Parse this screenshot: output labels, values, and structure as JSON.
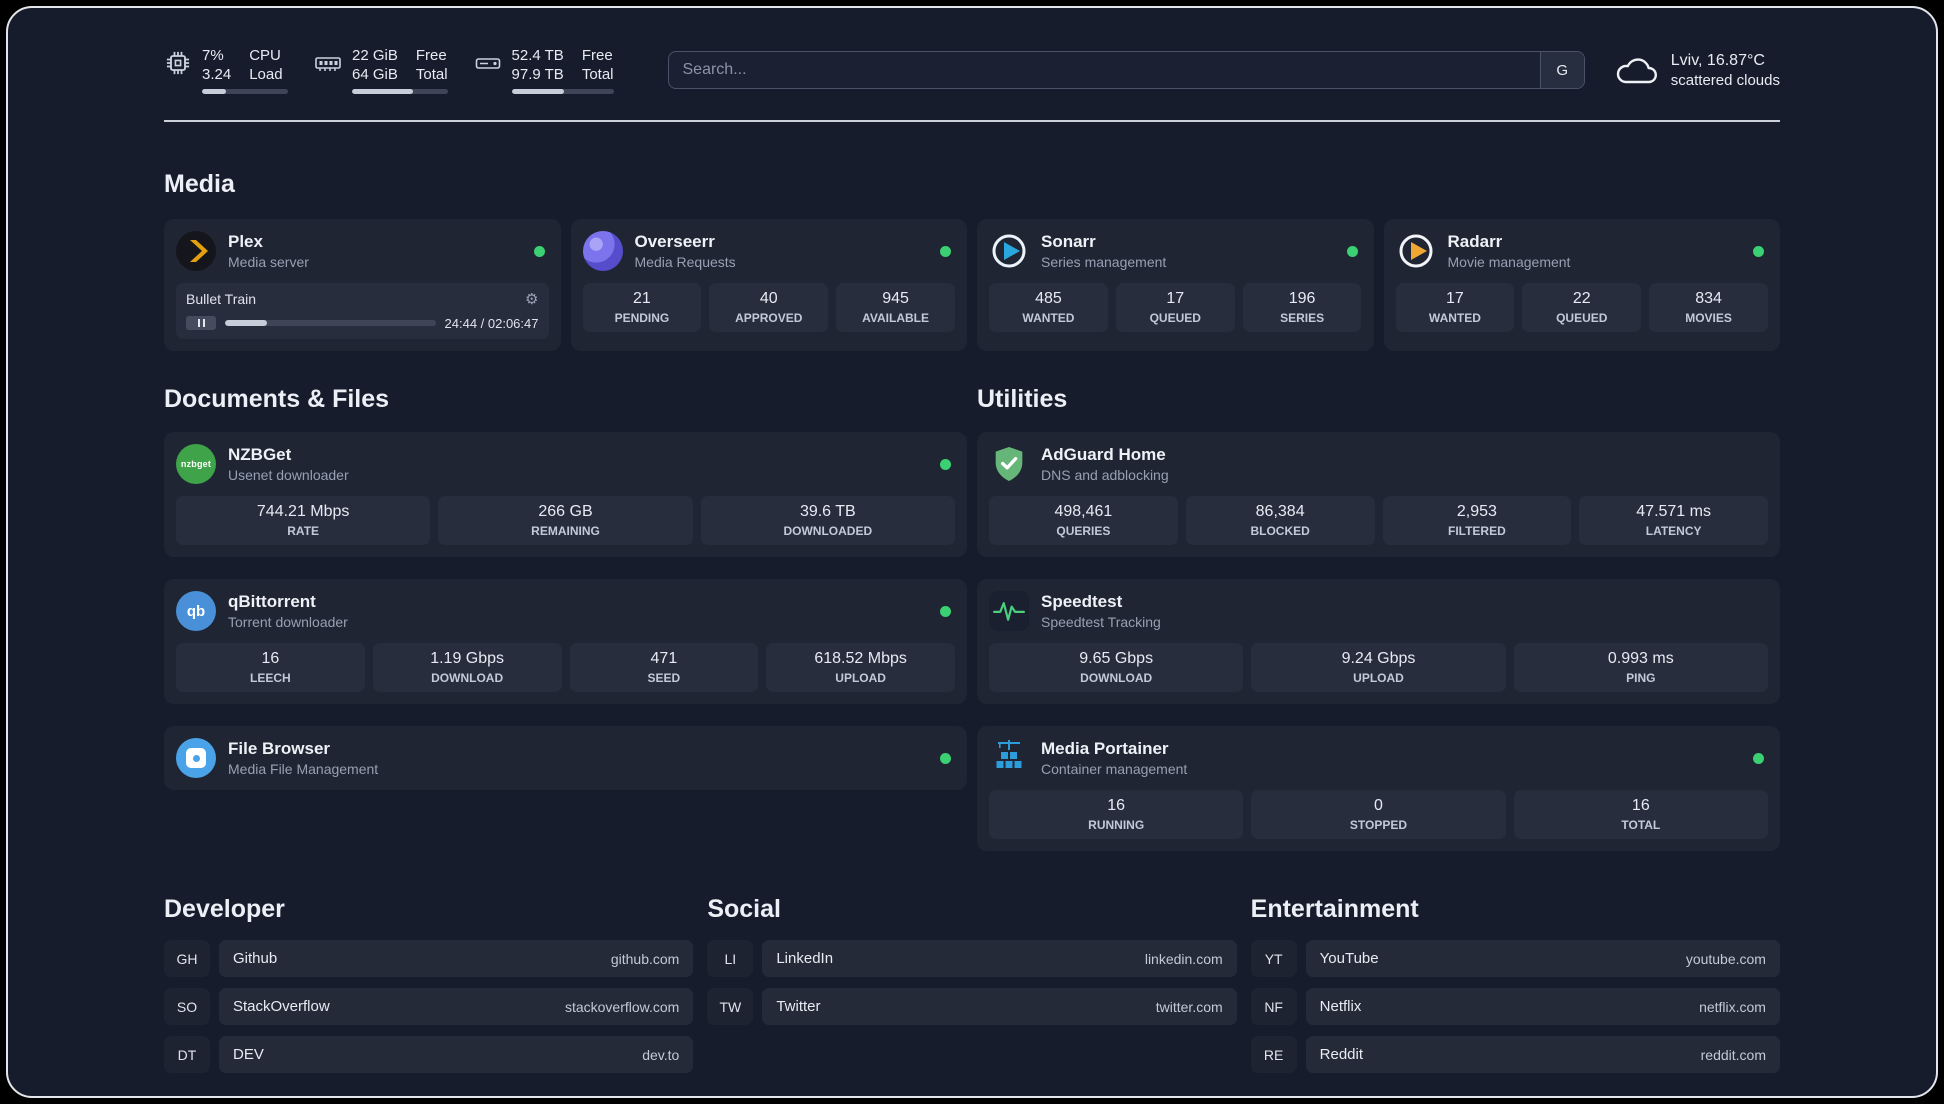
{
  "header": {
    "cpu": {
      "value1": "7%",
      "value2": "3.24",
      "label1": "CPU",
      "label2": "Load",
      "bar_pct": 28
    },
    "ram": {
      "value1": "22 GiB",
      "value2": "64 GiB",
      "label1": "Free",
      "label2": "Total",
      "bar_pct": 64
    },
    "disk": {
      "value1": "52.4 TB",
      "value2": "97.9 TB",
      "label1": "Free",
      "label2": "Total",
      "bar_pct": 51
    },
    "search": {
      "placeholder": "Search...",
      "button": "G"
    },
    "weather": {
      "location": "Lviv, 16.87°C",
      "condition": "scattered clouds"
    }
  },
  "media": {
    "title": "Media",
    "plex": {
      "name": "Plex",
      "subtitle": "Media server",
      "now_playing": "Bullet Train",
      "time": "24:44 / 02:06:47",
      "progress_pct": 20,
      "gear_glyph": "⚙"
    },
    "overseerr": {
      "name": "Overseerr",
      "subtitle": "Media Requests",
      "stats": [
        {
          "value": "21",
          "label": "PENDING"
        },
        {
          "value": "40",
          "label": "APPROVED"
        },
        {
          "value": "945",
          "label": "AVAILABLE"
        }
      ]
    },
    "sonarr": {
      "name": "Sonarr",
      "subtitle": "Series management",
      "stats": [
        {
          "value": "485",
          "label": "WANTED"
        },
        {
          "value": "17",
          "label": "QUEUED"
        },
        {
          "value": "196",
          "label": "SERIES"
        }
      ]
    },
    "radarr": {
      "name": "Radarr",
      "subtitle": "Movie management",
      "stats": [
        {
          "value": "17",
          "label": "WANTED"
        },
        {
          "value": "22",
          "label": "QUEUED"
        },
        {
          "value": "834",
          "label": "MOVIES"
        }
      ]
    }
  },
  "documents": {
    "title": "Documents & Files",
    "nzbget": {
      "name": "NZBGet",
      "subtitle": "Usenet downloader",
      "icon_text": "nzbget",
      "stats": [
        {
          "value": "744.21 Mbps",
          "label": "RATE"
        },
        {
          "value": "266 GB",
          "label": "REMAINING"
        },
        {
          "value": "39.6 TB",
          "label": "DOWNLOADED"
        }
      ]
    },
    "qbittorrent": {
      "name": "qBittorrent",
      "subtitle": "Torrent downloader",
      "icon_text": "qb",
      "stats": [
        {
          "value": "16",
          "label": "LEECH"
        },
        {
          "value": "1.19 Gbps",
          "label": "DOWNLOAD"
        },
        {
          "value": "471",
          "label": "SEED"
        },
        {
          "value": "618.52 Mbps",
          "label": "UPLOAD"
        }
      ]
    },
    "filebrowser": {
      "name": "File Browser",
      "subtitle": "Media File Management"
    }
  },
  "utilities": {
    "title": "Utilities",
    "adguard": {
      "name": "AdGuard Home",
      "subtitle": "DNS and adblocking",
      "stats": [
        {
          "value": "498,461",
          "label": "QUERIES"
        },
        {
          "value": "86,384",
          "label": "BLOCKED"
        },
        {
          "value": "2,953",
          "label": "FILTERED"
        },
        {
          "value": "47.571 ms",
          "label": "LATENCY"
        }
      ]
    },
    "speedtest": {
      "name": "Speedtest",
      "subtitle": "Speedtest Tracking",
      "stats": [
        {
          "value": "9.65 Gbps",
          "label": "DOWNLOAD"
        },
        {
          "value": "9.24 Gbps",
          "label": "UPLOAD"
        },
        {
          "value": "0.993 ms",
          "label": "PING"
        }
      ]
    },
    "portainer": {
      "name": "Media Portainer",
      "subtitle": "Container management",
      "stats": [
        {
          "value": "16",
          "label": "RUNNING"
        },
        {
          "value": "0",
          "label": "STOPPED"
        },
        {
          "value": "16",
          "label": "TOTAL"
        }
      ]
    }
  },
  "bookmarks": {
    "developer": {
      "title": "Developer",
      "items": [
        {
          "abbr": "GH",
          "name": "Github",
          "url": "github.com"
        },
        {
          "abbr": "SO",
          "name": "StackOverflow",
          "url": "stackoverflow.com"
        },
        {
          "abbr": "DT",
          "name": "DEV",
          "url": "dev.to"
        }
      ]
    },
    "social": {
      "title": "Social",
      "items": [
        {
          "abbr": "LI",
          "name": "LinkedIn",
          "url": "linkedin.com"
        },
        {
          "abbr": "TW",
          "name": "Twitter",
          "url": "twitter.com"
        }
      ]
    },
    "entertainment": {
      "title": "Entertainment",
      "items": [
        {
          "abbr": "YT",
          "name": "YouTube",
          "url": "youtube.com"
        },
        {
          "abbr": "NF",
          "name": "Netflix",
          "url": "netflix.com"
        },
        {
          "abbr": "RE",
          "name": "Reddit",
          "url": "reddit.com"
        }
      ]
    }
  }
}
